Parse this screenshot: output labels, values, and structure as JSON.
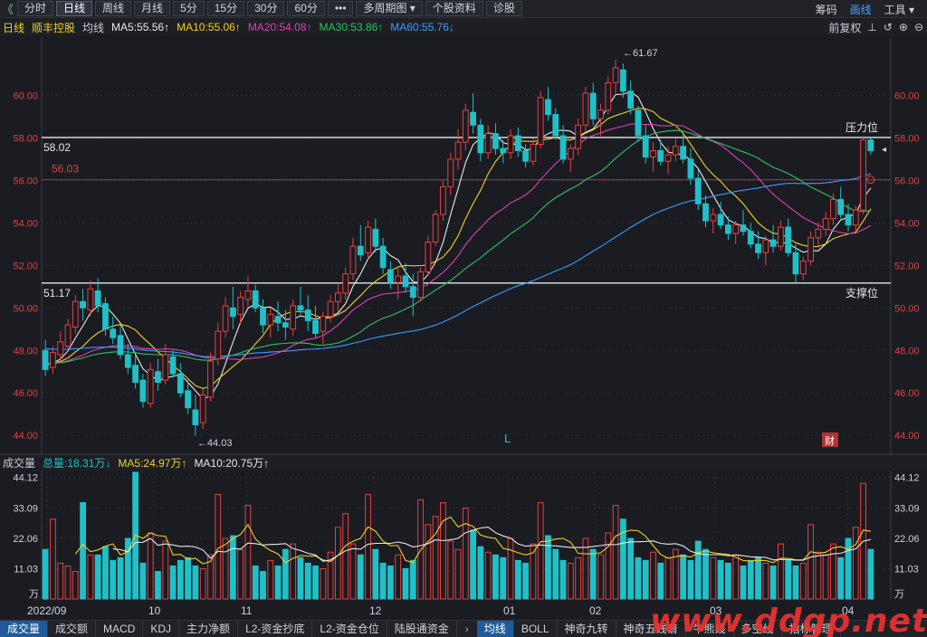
{
  "toolbar": {
    "back": "《",
    "tabs": [
      "分时",
      "日线",
      "周线",
      "月线",
      "5分",
      "15分",
      "30分",
      "60分",
      "•••",
      "多周期图 ▾",
      "个股资料",
      "诊股"
    ],
    "active_tab": "日线",
    "right": [
      "筹码",
      "画线",
      "工具 ▾"
    ]
  },
  "ma_bar": {
    "period": "日线",
    "name": "顺丰控股",
    "label": "均线",
    "items": [
      {
        "text": "MA5:55.56↑",
        "color": "#e8e8e8"
      },
      {
        "text": "MA10:55.06↑",
        "color": "#f0d020"
      },
      {
        "text": "MA20:54.08↑",
        "color": "#e040b0"
      },
      {
        "text": "MA30:53.86↑",
        "color": "#30c060"
      },
      {
        "text": "MA60:55.76↓",
        "color": "#3a9bff"
      }
    ],
    "right": [
      "前复权",
      "⊥",
      "↺",
      "⊕",
      "⊖"
    ]
  },
  "vol_bar": {
    "label": "成交量",
    "items": [
      {
        "text": "总量:18.31万↓",
        "color": "#1fc0c0"
      },
      {
        "text": "MA5:24.97万↑",
        "color": "#f0d020"
      },
      {
        "text": "MA10:20.75万↑",
        "color": "#e8e8e8"
      }
    ]
  },
  "bottom_tabs": [
    "成交量",
    "成交额",
    "MACD",
    "KDJ",
    "主力净额",
    "L2-资金抄底",
    "L2-资金仓位",
    "陆股通资金"
  ],
  "bottom_tabs2": [
    "均线",
    "BOLL",
    "神奇九转",
    "神奇五线谱",
    "牛熊线",
    "多空线",
    "指标管理"
  ],
  "bottom_gap": "›",
  "watermark": "www.ddgp.net",
  "chart_data": {
    "type": "candlestick",
    "price_axis": {
      "ticks": [
        "60.00",
        "58.00",
        "56.00",
        "54.00",
        "52.00",
        "50.00",
        "48.00",
        "46.00",
        "44.00"
      ],
      "range": [
        43.2,
        62.7
      ]
    },
    "volume_axis": {
      "ticks": [
        "44.12",
        "33.09",
        "22.06",
        "11.03"
      ],
      "unit": "万",
      "range": [
        0,
        46
      ]
    },
    "x_labels": [
      "2022/09",
      "10",
      "11",
      "12",
      "01",
      "02",
      "03",
      "04"
    ],
    "horizontal_lines": [
      {
        "value": 58.02,
        "label_left": "58.02",
        "label_right": "压力位",
        "color": "#e8e8e8"
      },
      {
        "value": 56.03,
        "label_left": "56.03",
        "label_right": "",
        "color": "#b83030"
      },
      {
        "value": 51.17,
        "label_left": "51.17",
        "label_right": "支撑位",
        "color": "#e8e8e8"
      }
    ],
    "annotations": {
      "high": "61.67",
      "low": "44.03",
      "marker_L": "L",
      "marker_cai": "财"
    },
    "ohlc": [
      [
        48.0,
        48.5,
        46.8,
        47.1
      ],
      [
        47.2,
        48.2,
        46.9,
        47.9
      ],
      [
        47.8,
        48.9,
        47.5,
        48.4
      ],
      [
        48.2,
        49.5,
        48.1,
        49.2
      ],
      [
        49.1,
        50.6,
        48.8,
        50.3
      ],
      [
        50.3,
        50.9,
        49.4,
        50.0
      ],
      [
        49.9,
        51.3,
        49.6,
        50.9
      ],
      [
        50.8,
        51.4,
        49.8,
        50.1
      ],
      [
        50.2,
        50.5,
        48.7,
        49.0
      ],
      [
        49.0,
        49.6,
        48.3,
        48.6
      ],
      [
        48.7,
        49.2,
        47.6,
        47.8
      ],
      [
        47.8,
        48.3,
        46.9,
        47.2
      ],
      [
        47.3,
        47.8,
        46.2,
        46.5
      ],
      [
        46.6,
        46.9,
        45.3,
        45.6
      ],
      [
        45.5,
        47.4,
        45.3,
        47.1
      ],
      [
        47.0,
        47.6,
        46.1,
        46.5
      ],
      [
        46.6,
        48.3,
        46.4,
        47.8
      ],
      [
        47.7,
        48.0,
        46.7,
        46.9
      ],
      [
        46.9,
        47.4,
        45.8,
        46.0
      ],
      [
        46.1,
        46.6,
        45.0,
        45.3
      ],
      [
        45.2,
        45.9,
        44.0,
        44.5
      ],
      [
        44.6,
        46.2,
        44.3,
        45.9
      ],
      [
        45.8,
        47.9,
        45.6,
        47.5
      ],
      [
        47.6,
        49.3,
        47.3,
        48.9
      ],
      [
        48.9,
        50.5,
        48.6,
        50.1
      ],
      [
        50.0,
        51.0,
        49.0,
        49.6
      ],
      [
        49.7,
        50.8,
        49.2,
        50.5
      ],
      [
        50.4,
        51.5,
        50.0,
        50.8
      ],
      [
        50.8,
        51.1,
        49.8,
        50.0
      ],
      [
        50.0,
        50.4,
        48.8,
        49.2
      ],
      [
        49.2,
        50.0,
        48.6,
        49.7
      ],
      [
        49.6,
        50.3,
        48.9,
        49.3
      ],
      [
        49.3,
        49.9,
        48.5,
        49.1
      ],
      [
        49.0,
        50.4,
        48.7,
        50.1
      ],
      [
        50.1,
        51.0,
        49.6,
        49.9
      ],
      [
        49.9,
        50.6,
        48.9,
        49.4
      ],
      [
        49.4,
        50.1,
        48.6,
        48.8
      ],
      [
        48.9,
        49.8,
        48.3,
        49.6
      ],
      [
        49.6,
        50.6,
        49.3,
        50.3
      ],
      [
        50.3,
        51.1,
        49.8,
        50.7
      ],
      [
        50.7,
        51.9,
        50.4,
        51.6
      ],
      [
        51.6,
        53.3,
        51.3,
        52.9
      ],
      [
        52.9,
        53.9,
        52.2,
        52.5
      ],
      [
        52.6,
        54.1,
        52.3,
        53.8
      ],
      [
        53.7,
        54.2,
        52.6,
        52.9
      ],
      [
        52.9,
        53.3,
        51.6,
        51.9
      ],
      [
        51.8,
        52.2,
        50.9,
        51.2
      ],
      [
        51.2,
        51.9,
        50.4,
        51.5
      ],
      [
        51.5,
        52.1,
        50.7,
        51.0
      ],
      [
        51.0,
        51.6,
        49.6,
        50.5
      ],
      [
        50.5,
        51.9,
        50.3,
        51.7
      ],
      [
        51.7,
        53.4,
        51.5,
        53.1
      ],
      [
        53.1,
        54.6,
        52.9,
        54.4
      ],
      [
        54.4,
        56.0,
        54.1,
        55.7
      ],
      [
        55.7,
        57.3,
        55.3,
        57.0
      ],
      [
        57.0,
        58.4,
        56.5,
        57.8
      ],
      [
        57.8,
        59.6,
        57.4,
        59.3
      ],
      [
        59.2,
        60.1,
        58.2,
        58.6
      ],
      [
        58.6,
        58.9,
        56.9,
        57.3
      ],
      [
        57.3,
        58.6,
        57.0,
        58.2
      ],
      [
        58.2,
        58.7,
        57.2,
        57.5
      ],
      [
        57.5,
        57.9,
        56.8,
        57.3
      ],
      [
        57.3,
        58.4,
        57.0,
        58.1
      ],
      [
        58.1,
        58.5,
        57.1,
        57.4
      ],
      [
        57.4,
        57.7,
        56.6,
        56.9
      ],
      [
        56.9,
        58.0,
        56.7,
        57.7
      ],
      [
        57.7,
        60.2,
        57.5,
        59.9
      ],
      [
        59.8,
        60.4,
        58.8,
        59.1
      ],
      [
        59.1,
        59.4,
        57.9,
        58.1
      ],
      [
        58.1,
        58.6,
        56.8,
        57.0
      ],
      [
        57.0,
        57.7,
        56.4,
        57.5
      ],
      [
        57.5,
        58.9,
        57.2,
        58.6
      ],
      [
        58.6,
        60.4,
        58.3,
        60.1
      ],
      [
        60.1,
        60.6,
        58.6,
        58.9
      ],
      [
        58.9,
        59.6,
        58.1,
        59.3
      ],
      [
        59.3,
        60.9,
        59.1,
        60.6
      ],
      [
        60.6,
        61.67,
        60.1,
        61.3
      ],
      [
        61.2,
        61.5,
        59.9,
        60.2
      ],
      [
        60.2,
        60.7,
        59.1,
        59.4
      ],
      [
        59.3,
        59.5,
        57.8,
        58.1
      ],
      [
        58.1,
        58.6,
        56.8,
        57.1
      ],
      [
        57.1,
        57.8,
        56.4,
        57.4
      ],
      [
        57.4,
        57.9,
        56.7,
        56.9
      ],
      [
        56.9,
        57.6,
        56.3,
        57.2
      ],
      [
        57.2,
        58.0,
        56.9,
        57.6
      ],
      [
        57.6,
        58.2,
        56.8,
        57.0
      ],
      [
        57.0,
        57.5,
        55.8,
        56.1
      ],
      [
        56.1,
        56.5,
        54.6,
        54.9
      ],
      [
        54.9,
        55.3,
        53.8,
        54.1
      ],
      [
        54.1,
        54.7,
        53.5,
        54.4
      ],
      [
        54.4,
        55.0,
        53.7,
        53.9
      ],
      [
        53.9,
        54.3,
        53.2,
        53.5
      ],
      [
        53.5,
        54.1,
        53.0,
        53.9
      ],
      [
        53.9,
        54.6,
        53.4,
        53.6
      ],
      [
        53.6,
        54.0,
        52.8,
        53.0
      ],
      [
        53.0,
        53.6,
        52.3,
        52.6
      ],
      [
        52.6,
        53.4,
        52.0,
        53.2
      ],
      [
        53.2,
        53.9,
        52.6,
        52.9
      ],
      [
        52.9,
        54.1,
        52.7,
        53.8
      ],
      [
        53.8,
        54.2,
        52.4,
        52.6
      ],
      [
        52.6,
        53.0,
        51.2,
        51.6
      ],
      [
        51.6,
        52.4,
        51.3,
        52.2
      ],
      [
        52.2,
        53.6,
        52.0,
        53.3
      ],
      [
        53.3,
        54.0,
        52.9,
        53.7
      ],
      [
        53.7,
        54.5,
        53.4,
        54.2
      ],
      [
        54.2,
        55.4,
        53.9,
        55.1
      ],
      [
        55.1,
        55.7,
        54.2,
        54.4
      ],
      [
        54.4,
        54.9,
        53.6,
        53.9
      ],
      [
        53.9,
        54.8,
        53.6,
        54.6
      ],
      [
        54.6,
        58.1,
        54.4,
        57.9
      ],
      [
        57.9,
        58.0,
        57.2,
        57.4
      ]
    ],
    "volume": [
      18,
      29,
      13,
      12,
      10,
      35,
      16,
      16,
      19,
      14,
      15,
      22,
      46,
      13,
      24,
      10,
      21,
      12,
      14,
      15,
      12,
      11,
      16,
      38,
      22,
      23,
      18,
      34,
      12,
      10,
      14,
      12,
      18,
      20,
      15,
      13,
      12,
      11,
      17,
      26,
      31,
      20,
      16,
      38,
      18,
      13,
      12,
      16,
      11,
      14,
      36,
      27,
      30,
      35,
      21,
      18,
      33,
      25,
      19,
      17,
      16,
      15,
      22,
      14,
      13,
      20,
      35,
      23,
      18,
      14,
      13,
      15,
      22,
      18,
      16,
      24,
      34,
      29,
      22,
      15,
      14,
      17,
      13,
      15,
      18,
      16,
      14,
      21,
      18,
      15,
      14,
      13,
      16,
      12,
      14,
      15,
      13,
      12,
      20,
      14,
      12,
      13,
      27,
      17,
      16,
      20,
      15,
      22,
      26,
      42,
      18
    ],
    "ma_series": [
      "MA5",
      "MA10",
      "MA20",
      "MA30",
      "MA60"
    ]
  }
}
